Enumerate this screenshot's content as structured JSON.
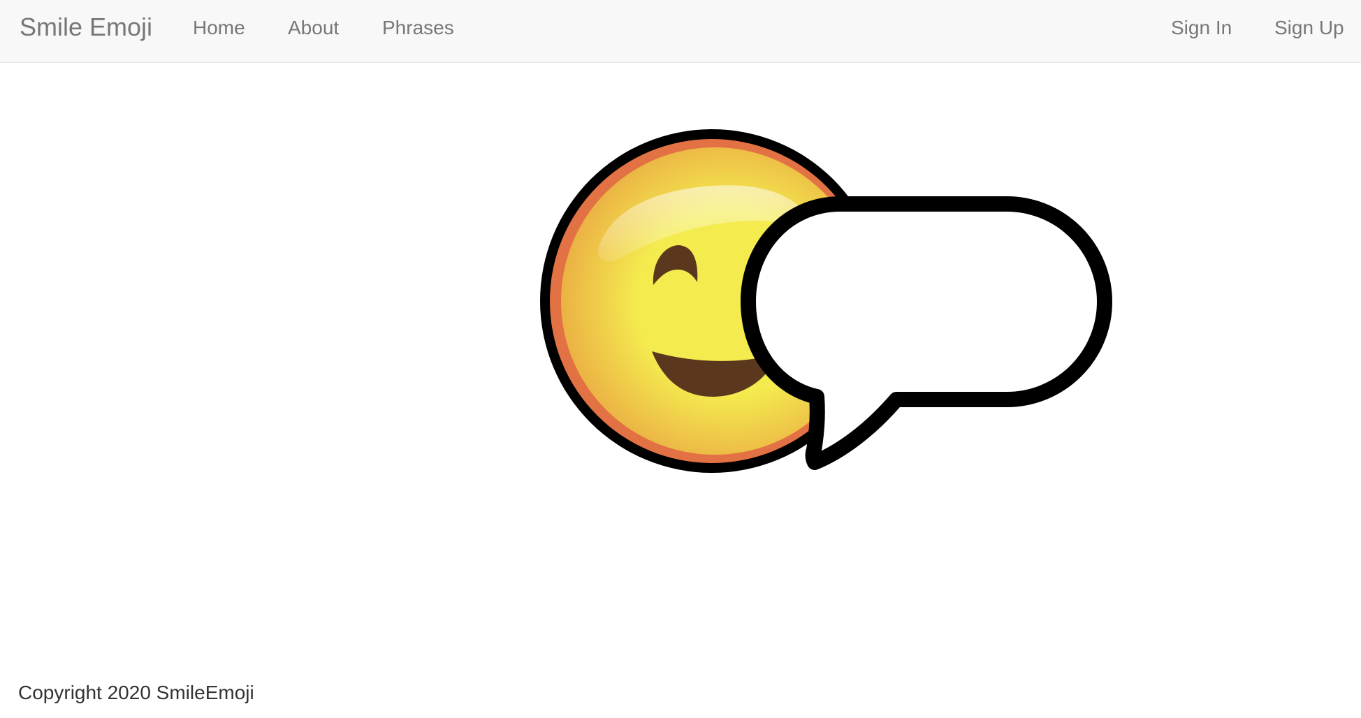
{
  "navbar": {
    "brand": "Smile Emoji",
    "left_links": [
      "Home",
      "About",
      "Phrases"
    ],
    "right_links": [
      "Sign In",
      "Sign Up"
    ]
  },
  "hero": {
    "image_icon": "smiley-with-speech-bubble-icon",
    "colors": {
      "face_center": "#F4EB4F",
      "face_edge": "#EBB144",
      "face_rim": "#E27243",
      "features": "#5B381D",
      "outline": "#000000",
      "bubble_fill": "#FFFFFF"
    }
  },
  "footer": {
    "copyright": "Copyright 2020 SmileEmoji"
  }
}
